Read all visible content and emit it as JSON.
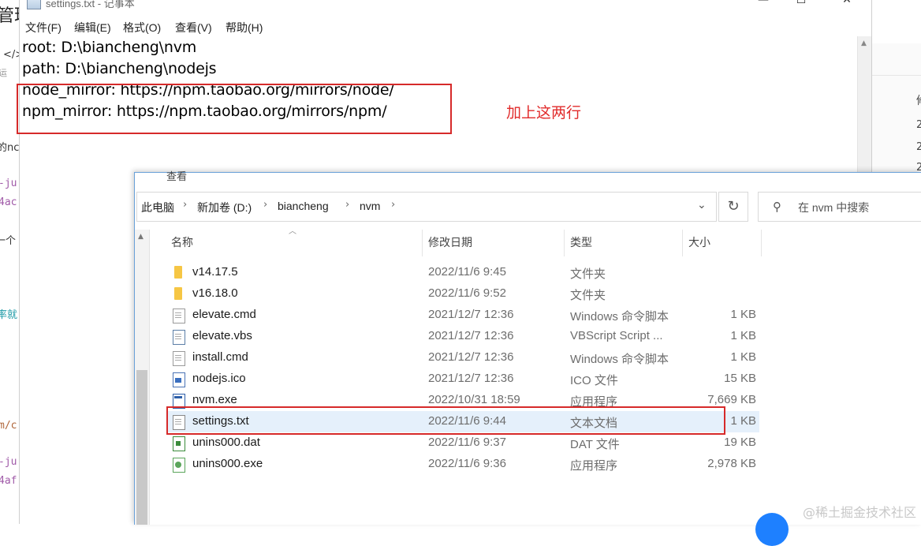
{
  "background": {
    "fragments": [
      "管理",
      "</>",
      "运",
      "的nc",
      "-ju",
      "4ac",
      "一个",
      "率就",
      "m/c",
      "-ju",
      "4af"
    ],
    "right_fragments": [
      "修",
      "2",
      "2",
      "2"
    ]
  },
  "notepad": {
    "title": "settings.txt - 记事本",
    "menu": [
      "文件(F)",
      "编辑(E)",
      "格式(O)",
      "查看(V)",
      "帮助(H)"
    ],
    "lines": [
      "root: D:\\biancheng\\nvm",
      "path: D:\\biancheng\\nodejs",
      "node_mirror: https://npm.taobao.org/mirrors/node/",
      "npm_mirror: https://npm.taobao.org/mirrors/npm/"
    ],
    "annotation": "加上这两行",
    "controls": {
      "minimize": "—",
      "maximize": "☐",
      "close": "✕"
    }
  },
  "explorer": {
    "ribbon_peek": "查看",
    "breadcrumb": [
      "此电脑",
      "新加卷 (D:)",
      "biancheng",
      "nvm"
    ],
    "search_placeholder": "在 nvm 中搜索",
    "columns": {
      "name": "名称",
      "date": "修改日期",
      "type": "类型",
      "size": "大小"
    },
    "files": [
      {
        "name": "v14.17.5",
        "date": "2022/11/6 9:45",
        "type": "文件夹",
        "size": "",
        "icon": "folder-icon"
      },
      {
        "name": "v16.18.0",
        "date": "2022/11/6 9:52",
        "type": "文件夹",
        "size": "",
        "icon": "folder-icon"
      },
      {
        "name": "elevate.cmd",
        "date": "2021/12/7 12:36",
        "type": "Windows 命令脚本",
        "size": "1 KB",
        "icon": "cmd-file-icon"
      },
      {
        "name": "elevate.vbs",
        "date": "2021/12/7 12:36",
        "type": "VBScript Script ...",
        "size": "1 KB",
        "icon": "vbs-file-icon"
      },
      {
        "name": "install.cmd",
        "date": "2021/12/7 12:36",
        "type": "Windows 命令脚本",
        "size": "1 KB",
        "icon": "cmd-file-icon"
      },
      {
        "name": "nodejs.ico",
        "date": "2021/12/7 12:36",
        "type": "ICO 文件",
        "size": "15 KB",
        "icon": "ico-file-icon"
      },
      {
        "name": "nvm.exe",
        "date": "2022/10/31 18:59",
        "type": "应用程序",
        "size": "7,669 KB",
        "icon": "exe-file-icon"
      },
      {
        "name": "settings.txt",
        "date": "2022/11/6 9:44",
        "type": "文本文档",
        "size": "1 KB",
        "icon": "txt-file-icon"
      },
      {
        "name": "unins000.dat",
        "date": "2022/11/6 9:37",
        "type": "DAT 文件",
        "size": "19 KB",
        "icon": "dat-file-icon"
      },
      {
        "name": "unins000.exe",
        "date": "2022/11/6 9:36",
        "type": "应用程序",
        "size": "2,978 KB",
        "icon": "uninstaller-icon"
      }
    ],
    "selected_file": "settings.txt"
  },
  "watermark": "@稀土掘金技术社区",
  "colors": {
    "highlight_red": "#d62a2a",
    "selection_blue": "#e5f0fb",
    "folder_yellow": "#f6c644"
  }
}
